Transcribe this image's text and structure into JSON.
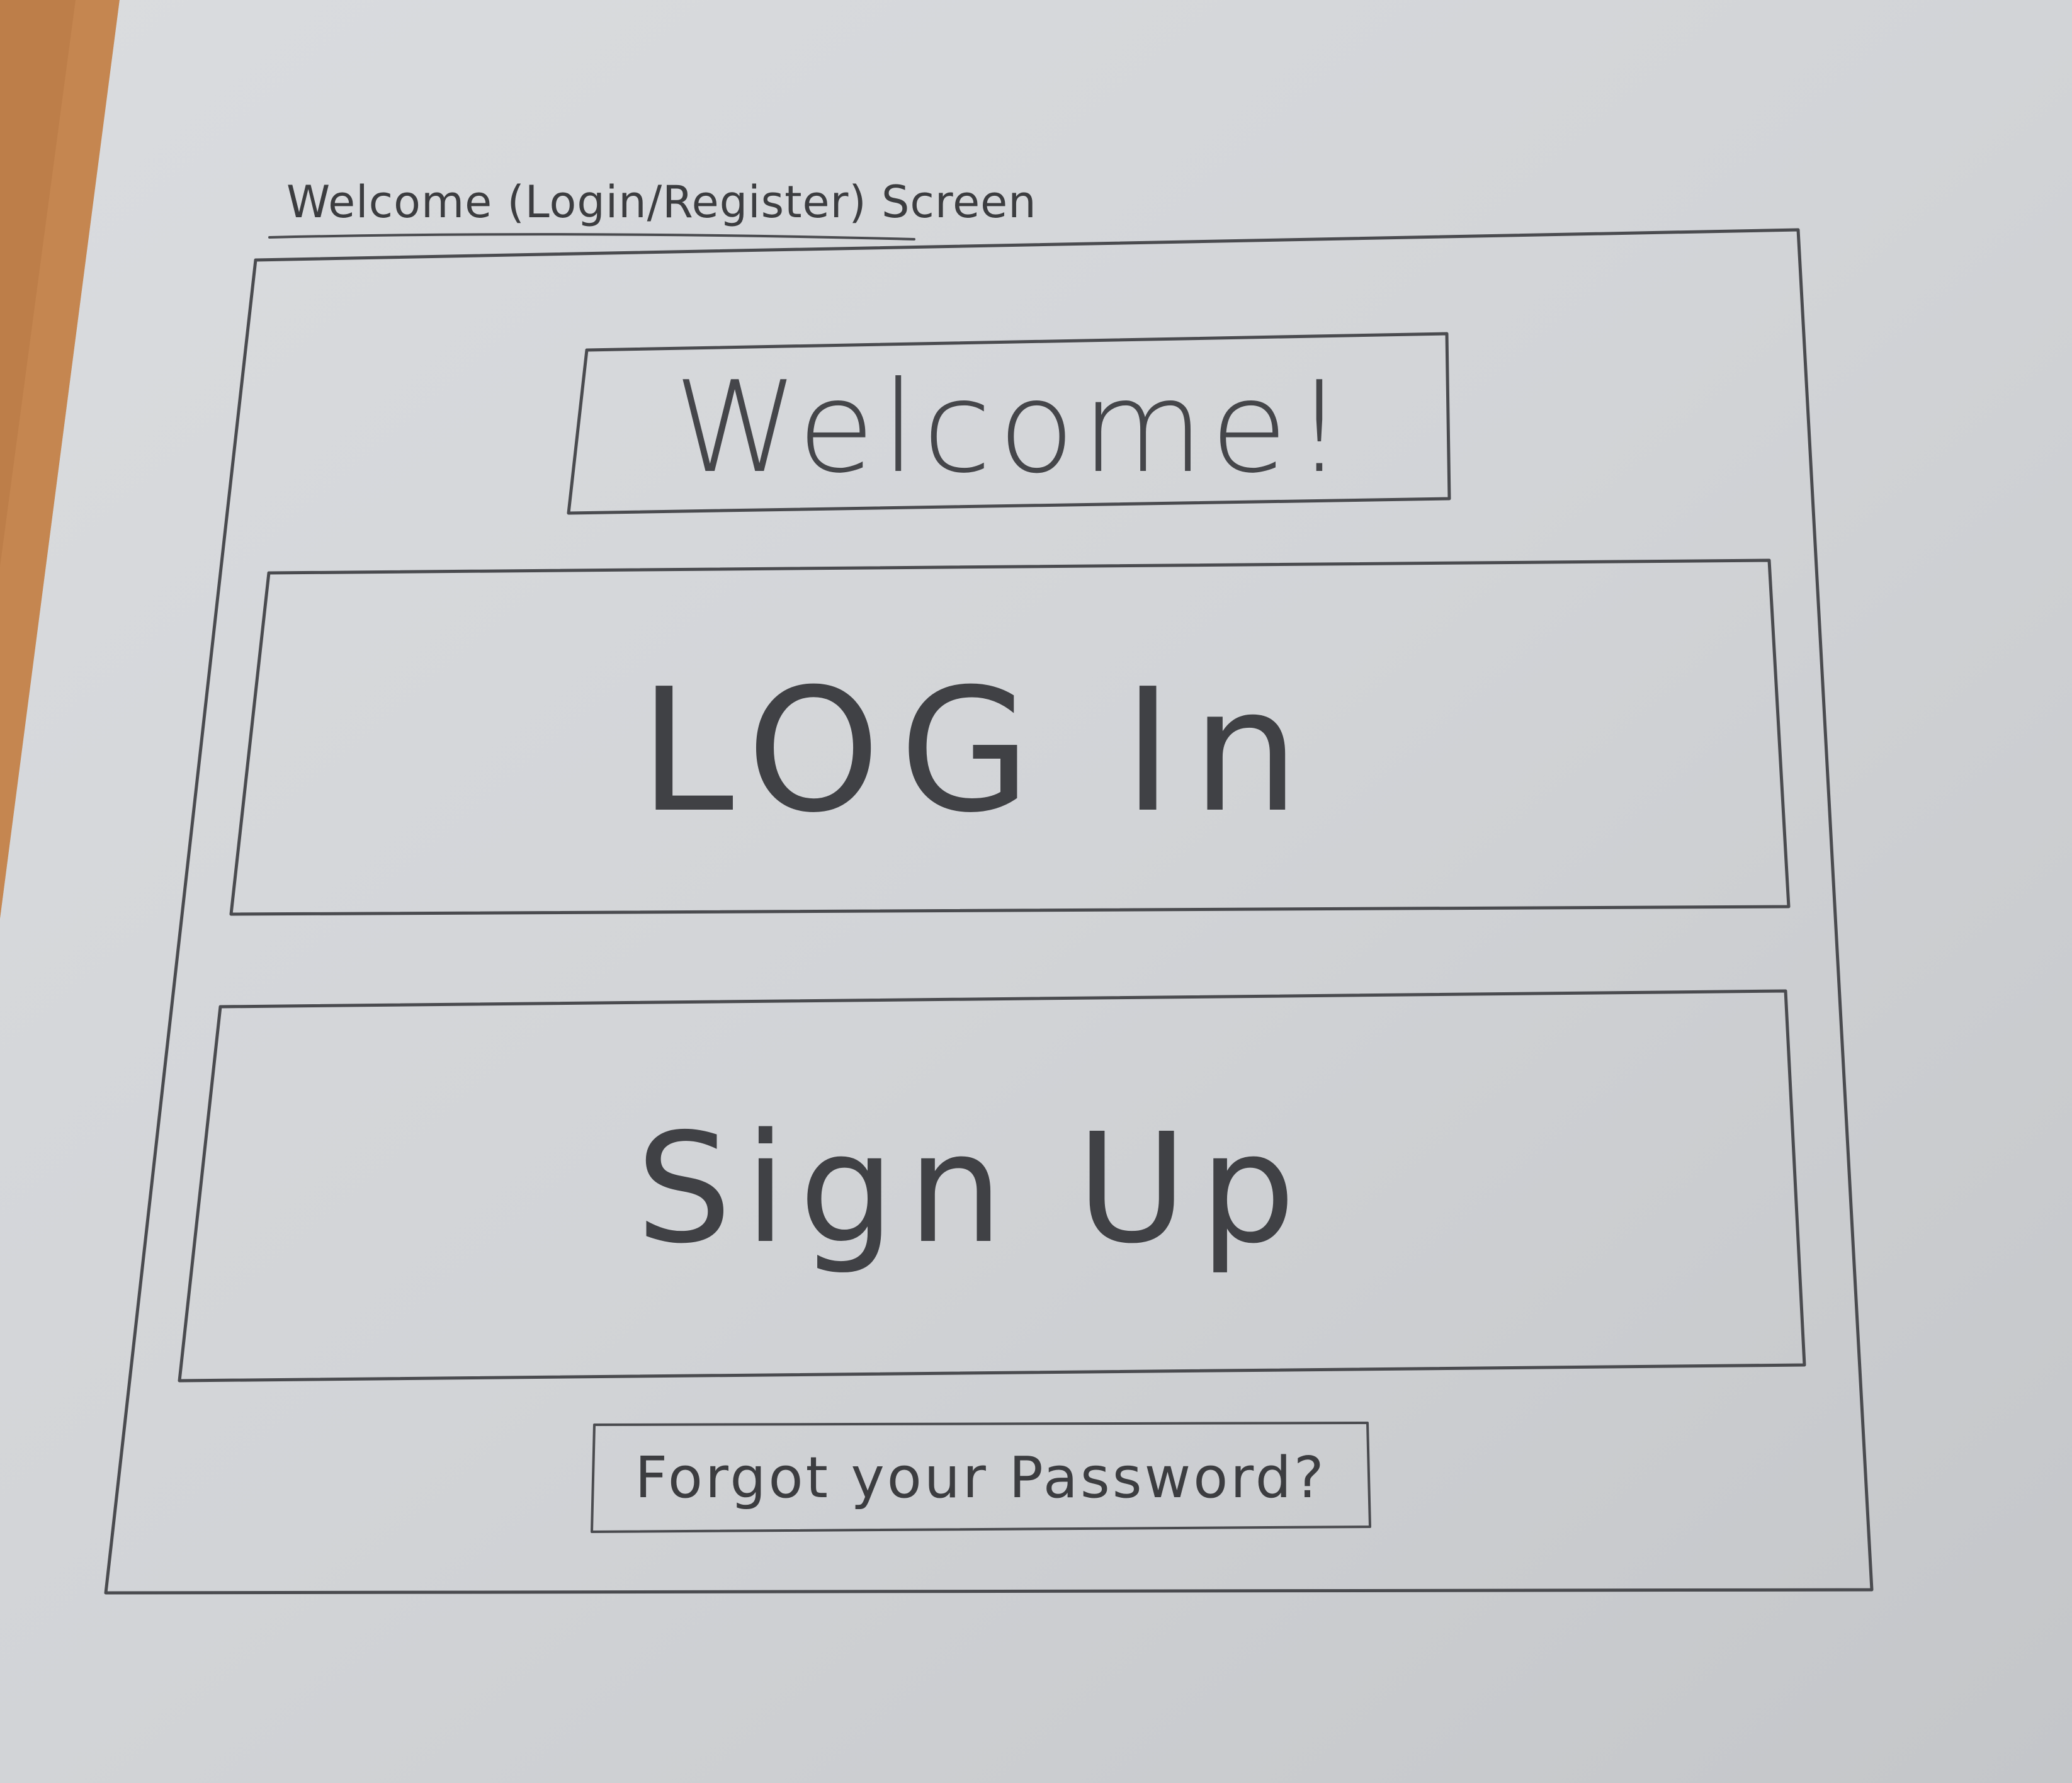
{
  "caption": "Welcome (Login/Register) Screen",
  "welcome": {
    "label": "Welcome!"
  },
  "login": {
    "label": "LOG In"
  },
  "signup": {
    "label": "Sign Up"
  },
  "forgot": {
    "label": "Forgot your Password?"
  },
  "colors": {
    "desk": "#c9894f",
    "paper": "#dcdfe1",
    "pencil": "#46474b"
  }
}
